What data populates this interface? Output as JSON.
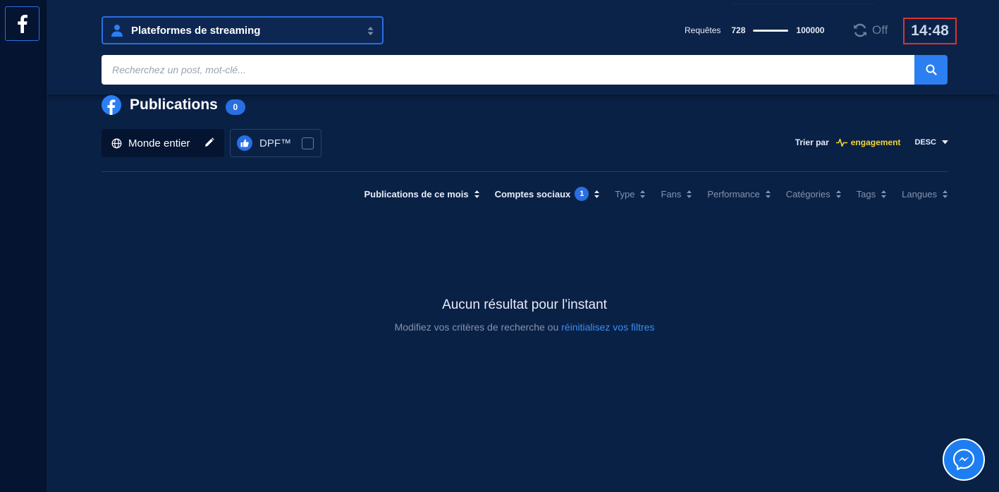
{
  "colors": {
    "background": "#0a2146",
    "sidebar": "#051430",
    "accent": "#2a6fe2",
    "search_button": "#2b7ff0",
    "highlight_yellow": "#f4d434",
    "clock_border": "#e0312c",
    "link": "#3b8df5"
  },
  "sidebar": {
    "network_icon": "facebook-icon"
  },
  "header": {
    "platform_select": {
      "icon": "user-icon",
      "label": "Plateformes de streaming"
    },
    "requests": {
      "label": "Requêtes",
      "used": "728",
      "limit": "100000",
      "usage_fraction": 0.00728
    },
    "refresh": {
      "icon": "refresh-icon",
      "state": "Off"
    },
    "clock": "14:48"
  },
  "search": {
    "placeholder": "Recherchez un post, mot-clé...",
    "value": "",
    "button_icon": "search-icon"
  },
  "publications": {
    "title": "Publications",
    "count": "0"
  },
  "region": {
    "label": "Monde entier",
    "icon": "globe-icon",
    "edit_icon": "pencil-icon"
  },
  "dpf": {
    "label": "DPF™",
    "icon": "thumbs-up-icon",
    "checked": false
  },
  "sort": {
    "label": "Trier par",
    "field": "engagement",
    "direction": "DESC"
  },
  "filters": [
    {
      "label": "Publications de ce mois",
      "active": true,
      "badge": ""
    },
    {
      "label": "Comptes sociaux",
      "active": true,
      "badge": "1"
    },
    {
      "label": "Type",
      "active": false,
      "badge": ""
    },
    {
      "label": "Fans",
      "active": false,
      "badge": ""
    },
    {
      "label": "Performance",
      "active": false,
      "badge": ""
    },
    {
      "label": "Catégories",
      "active": false,
      "badge": ""
    },
    {
      "label": "Tags",
      "active": false,
      "badge": ""
    },
    {
      "label": "Langues",
      "active": false,
      "badge": ""
    }
  ],
  "empty_state": {
    "title": "Aucun résultat pour l'instant",
    "subtitle": "Modifiez vos critères de recherche ou",
    "reset_link": "réinitialisez vos filtres"
  },
  "chat": {
    "icon": "messenger-icon"
  }
}
